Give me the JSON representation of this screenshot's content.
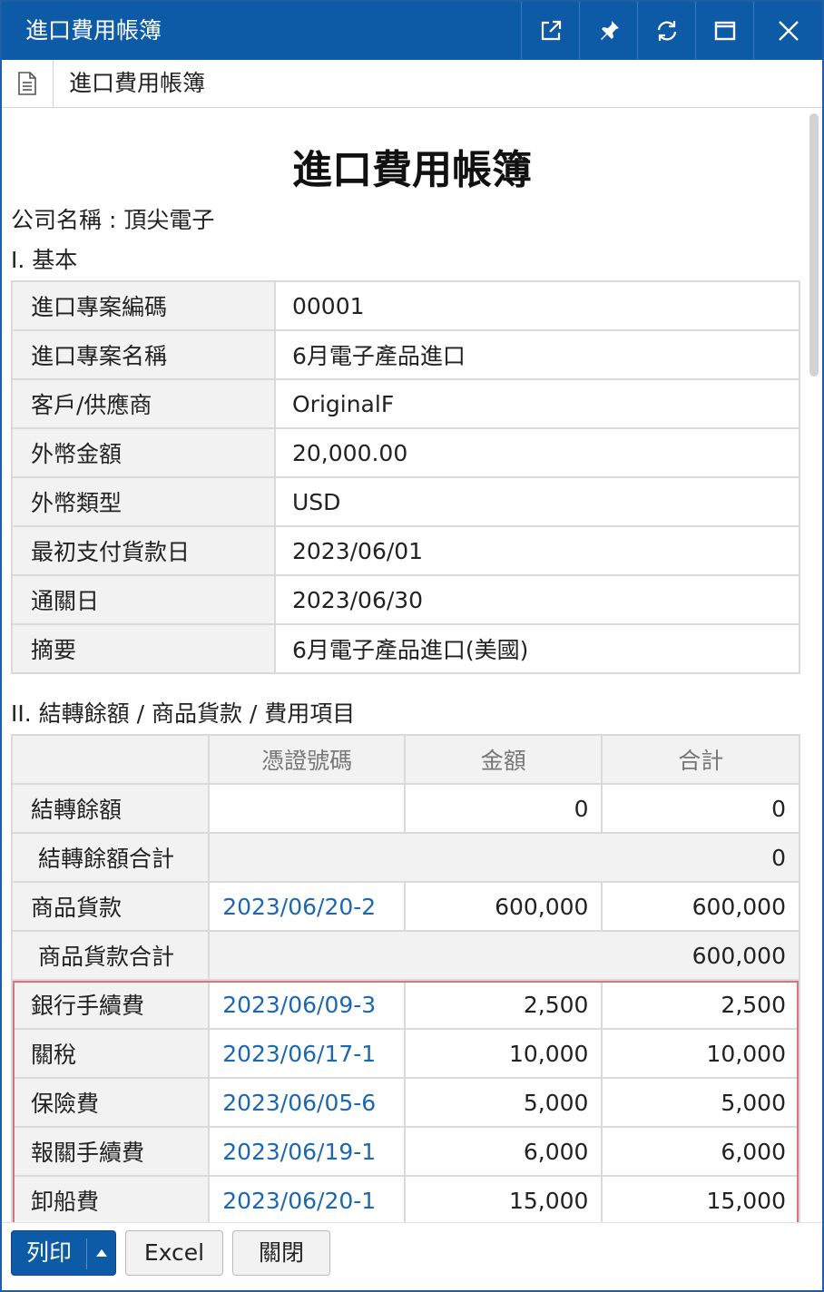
{
  "window": {
    "title": "進口費用帳簿",
    "tab_title": "進口費用帳簿"
  },
  "report": {
    "title": "進口費用帳簿",
    "company": "公司名稱 : 頂尖電子",
    "section1": "I. 基本",
    "section2": "II. 結轉餘額 / 商品貨款 / 費用項目"
  },
  "basic": {
    "rows": [
      {
        "label": "進口專案編碼",
        "value": "00001"
      },
      {
        "label": "進口專案名稱",
        "value": "6月電子產品進口"
      },
      {
        "label": "客戶/供應商",
        "value": "OriginalF"
      },
      {
        "label": "外幣金額",
        "value": "20,000.00"
      },
      {
        "label": "外幣類型",
        "value": "USD"
      },
      {
        "label": "最初支付貨款日",
        "value": "2023/06/01"
      },
      {
        "label": "通關日",
        "value": "2023/06/30"
      },
      {
        "label": "摘要",
        "value": "6月電子產品進口(美國)"
      }
    ]
  },
  "ledger": {
    "headers": [
      "",
      "憑證號碼",
      "金額",
      "合計"
    ],
    "carryover": {
      "label": "結轉餘額",
      "voucher": "",
      "amount": "0",
      "total": "0"
    },
    "carryover_total": {
      "label": "結轉餘額合計",
      "value": "0"
    },
    "goods": {
      "label": "商品貨款",
      "voucher": "2023/06/20-2",
      "amount": "600,000",
      "total": "600,000"
    },
    "goods_total": {
      "label": "商品貨款合計",
      "value": "600,000"
    },
    "expenses": [
      {
        "label": "銀行手續費",
        "voucher": "2023/06/09-3",
        "amount": "2,500",
        "total": "2,500"
      },
      {
        "label": "關稅",
        "voucher": "2023/06/17-1",
        "amount": "10,000",
        "total": "10,000"
      },
      {
        "label": "保險費",
        "voucher": "2023/06/05-6",
        "amount": "5,000",
        "total": "5,000"
      },
      {
        "label": "報關手續費",
        "voucher": "2023/06/19-1",
        "amount": "6,000",
        "total": "6,000"
      },
      {
        "label": "卸船費",
        "voucher": "2023/06/20-1",
        "amount": "15,000",
        "total": "15,000"
      }
    ]
  },
  "footer": {
    "print_label": "列印",
    "excel_label": "Excel",
    "close_label": "關閉"
  },
  "colors": {
    "titlebar": "#0d5aa7",
    "link": "#1d67b0",
    "highlight_border": "#d9737e"
  },
  "icons": [
    "open-new-window-icon",
    "pin-icon",
    "refresh-icon",
    "maximize-icon",
    "close-icon",
    "document-icon",
    "caret-up-icon"
  ],
  "scroll": {
    "position_fraction": 0
  }
}
